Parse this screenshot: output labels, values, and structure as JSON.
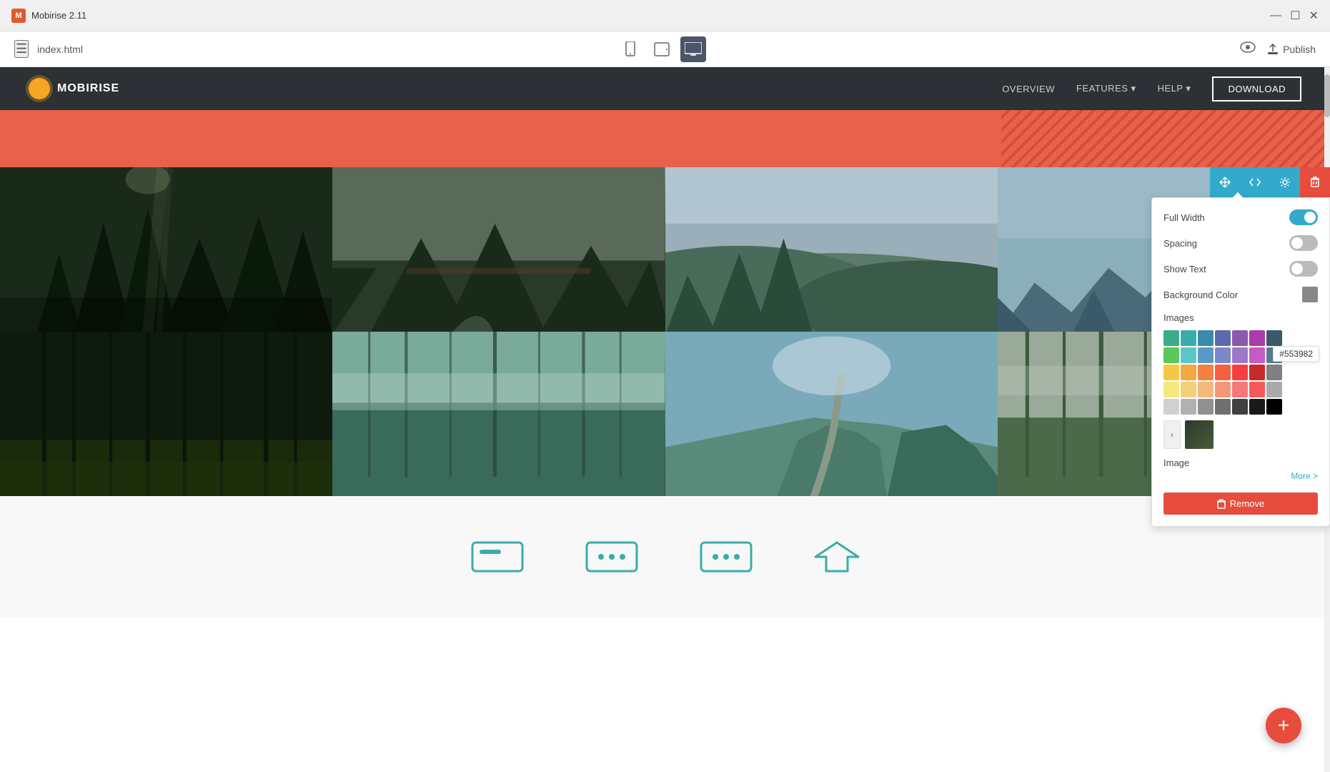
{
  "app": {
    "title": "Mobirise 2.11",
    "logo": "M"
  },
  "titlebar": {
    "title": "Mobirise 2.11",
    "minimize": "—",
    "maximize": "☐",
    "close": "✕"
  },
  "menubar": {
    "filename": "index.html",
    "publish_label": "Publish"
  },
  "site_nav": {
    "brand": "MOBIRISE",
    "links": [
      {
        "label": "OVERVIEW",
        "has_dropdown": false
      },
      {
        "label": "FEATURES",
        "has_dropdown": true
      },
      {
        "label": "HELP",
        "has_dropdown": true
      }
    ],
    "download_label": "DOWNLOAD"
  },
  "toolbar": {
    "move_icon": "↕",
    "code_icon": "</>",
    "settings_icon": "⚙",
    "delete_icon": "🗑"
  },
  "settings_panel": {
    "full_width_label": "Full Width",
    "full_width_on": true,
    "spacing_label": "Spacing",
    "spacing_on": false,
    "show_text_label": "Show Text",
    "show_text_on": false,
    "bg_color_label": "Background Color",
    "images_label": "Images",
    "image_label": "Image",
    "more_label": "More >",
    "color_tooltip": "#553982",
    "remove_label": "Remove",
    "colors": [
      "#3aac8a",
      "#3aacac",
      "#3a8aac",
      "#5a6aac",
      "#8a5aac",
      "#ac3aac",
      "#3a5a6a",
      "#5ac85a",
      "#5ac8c8",
      "#5a9ac8",
      "#7a8ac8",
      "#9a7ac8",
      "#c85ac8",
      "#5a7a8a",
      "#f5c842",
      "#f5a842",
      "#f58042",
      "#f56042",
      "#f54042",
      "#c82a2a",
      "#808080",
      "#f5e87a",
      "#f5d07a",
      "#f5b87a",
      "#f5987a",
      "#f5787a",
      "#f55a5a",
      "#aaaaaa",
      "#f0f0a0",
      "#e0c080",
      "#c0a060",
      "#a08040",
      "#806020",
      "#603010",
      "#333333",
      "#d0d0d0",
      "#b0b0b0",
      "#909090",
      "#707070",
      "#404040",
      "#1a1a1a",
      "#000000"
    ]
  },
  "fab": {
    "icon": "+"
  }
}
